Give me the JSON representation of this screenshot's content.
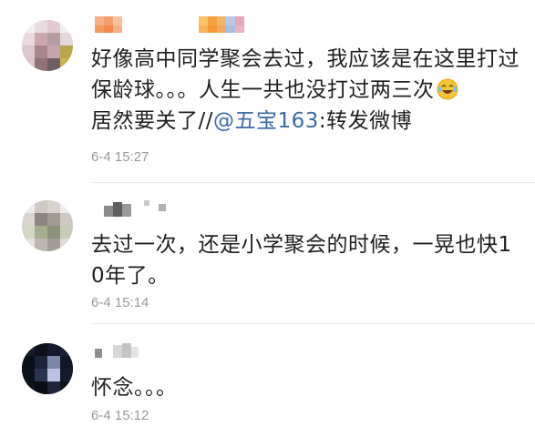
{
  "comments": [
    {
      "text_before": "好像高中同学聚会去过，我应该是在这里打过保龄球。。。人生一共也没打过两三次",
      "emoji_icon": "laughing-crying-emoji",
      "text_mid": "居然要关了//",
      "mention": "@五宝163",
      "text_after": ":转发微博",
      "time": "6-4 15:27"
    },
    {
      "text": "去过一次，还是小学聚会的时候，一晃也快10年了。",
      "time": "6-4 15:14"
    },
    {
      "text": "怀念。。。",
      "time": "6-4 15:12"
    }
  ]
}
